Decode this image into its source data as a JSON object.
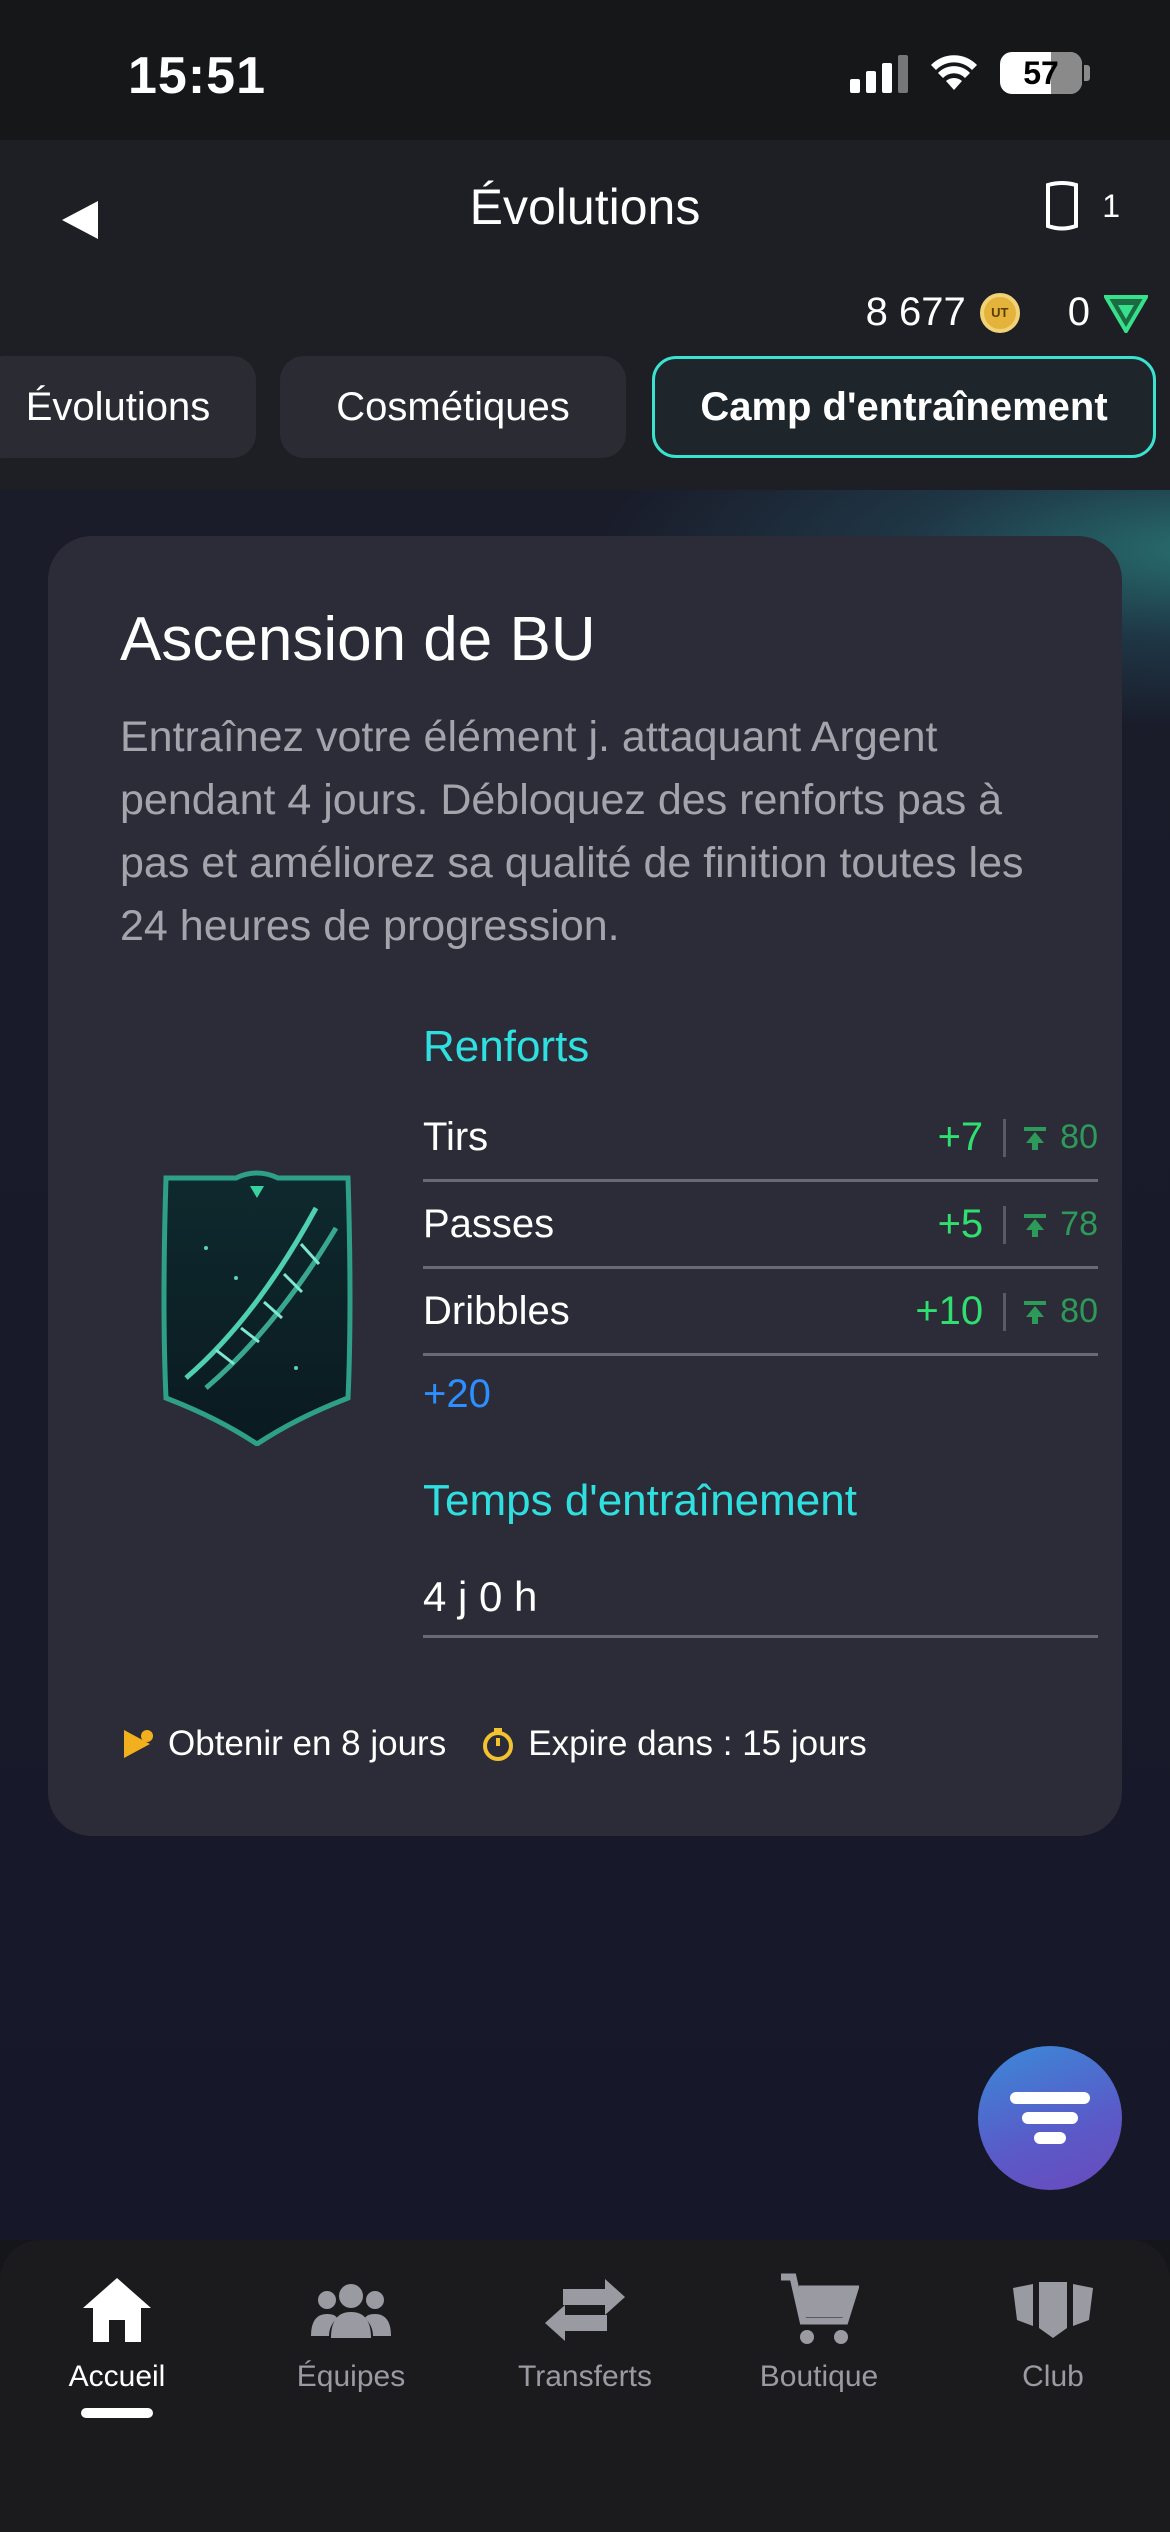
{
  "status_bar": {
    "time": "15:51",
    "battery": "57"
  },
  "header": {
    "title": "Évolutions",
    "shield_count": "1",
    "coins": "8 677",
    "coin_label": "UT",
    "points": "0"
  },
  "tabs": [
    {
      "label": "Évolutions",
      "active": false
    },
    {
      "label": "Cosmétiques",
      "active": false
    },
    {
      "label": "Camp d'entraînement",
      "active": true
    }
  ],
  "card": {
    "title": "Ascension de BU",
    "description": "Entraînez votre élément j. attaquant Argent pendant 4 jours. Débloquez des renforts pas à pas et améliorez sa qualité de finition toutes les 24 heures de progression.",
    "boosts_label": "Renforts",
    "boosts": [
      {
        "name": "Tirs",
        "plus": "+7",
        "cap": "80"
      },
      {
        "name": "Passes",
        "plus": "+5",
        "cap": "78"
      },
      {
        "name": "Dribbles",
        "plus": "+10",
        "cap": "80"
      }
    ],
    "total_boost": "+20",
    "training_label": "Temps d'entraînement",
    "training_time": "4 j 0 h",
    "obtain_text": "Obtenir en 8 jours",
    "expire_text": "Expire dans : 15 jours"
  },
  "nav": [
    {
      "label": "Accueil",
      "icon": "home-icon",
      "active": true
    },
    {
      "label": "Équipes",
      "icon": "people-icon",
      "active": false
    },
    {
      "label": "Transferts",
      "icon": "transfer-arrows-icon",
      "active": false
    },
    {
      "label": "Boutique",
      "icon": "cart-icon",
      "active": false
    },
    {
      "label": "Club",
      "icon": "club-icon",
      "active": false
    }
  ],
  "colors": {
    "accent_teal": "#2fe0e0",
    "boost_green": "#2fdf6f",
    "total_blue": "#2d8fff",
    "coin_gold": "#e3b33c",
    "timer_yellow": "#f2c230"
  }
}
